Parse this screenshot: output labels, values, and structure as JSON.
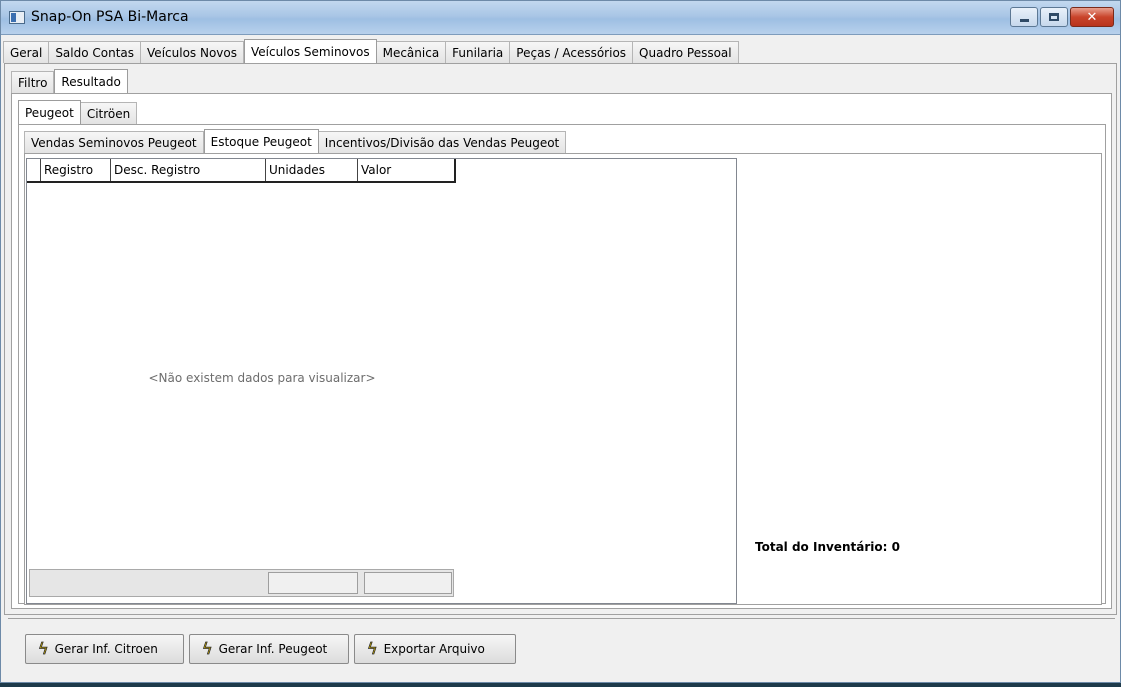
{
  "window": {
    "title": "Snap-On PSA Bi-Marca"
  },
  "main_tabs": [
    {
      "label": "Geral"
    },
    {
      "label": "Saldo Contas"
    },
    {
      "label": "Veículos Novos"
    },
    {
      "label": "Veículos Seminovos",
      "active": true
    },
    {
      "label": "Mecânica"
    },
    {
      "label": "Funilaria"
    },
    {
      "label": "Peças / Acessórios"
    },
    {
      "label": "Quadro Pessoal"
    }
  ],
  "sub_tabs": [
    {
      "label": "Filtro"
    },
    {
      "label": "Resultado",
      "active": true
    }
  ],
  "brand_tabs": [
    {
      "label": "Peugeot",
      "active": true
    },
    {
      "label": "Citröen"
    }
  ],
  "report_tabs": [
    {
      "label": "Vendas Seminovos Peugeot"
    },
    {
      "label": "Estoque Peugeot",
      "active": true
    },
    {
      "label": "Incentivos/Divisão das Vendas Peugeot"
    }
  ],
  "grid": {
    "columns": [
      "Registro",
      "Desc. Registro",
      "Unidades",
      "Valor"
    ],
    "empty_message": "<Não existem dados para visualizar>"
  },
  "summary": {
    "total_label": "Total do Inventário: 0"
  },
  "buttons": {
    "citroen": "Gerar Inf. Citroen",
    "peugeot": "Gerar Inf. Peugeot",
    "export": "Exportar Arquivo"
  },
  "icons": {
    "button_icon": "lightning-bolt-icon",
    "window_icon": "app-window-icon"
  },
  "colors": {
    "titlebar": "#a9c6e6",
    "window_bg": "#f0f0f0",
    "close_button": "#c9442b",
    "bolt": "#e8c300"
  }
}
